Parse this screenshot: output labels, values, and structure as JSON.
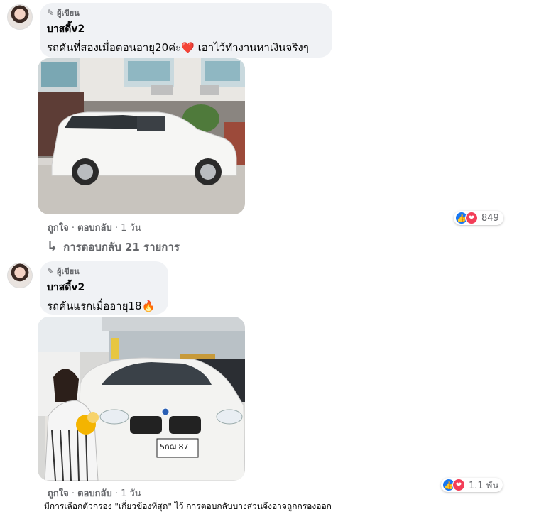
{
  "comments": [
    {
      "author_badge": "ผู้เขียน",
      "name": "บาสดี้v2",
      "text": "รถคันที่สองเมื่อตอนอายุ20ค่ะ❤️ เอาไว้ทำงานหาเงินจริงๆ",
      "like_label": "ถูกใจ",
      "reply_label": "ตอบกลับ",
      "time": "1 วัน",
      "reaction_count": "849"
    },
    {
      "author_badge": "ผู้เขียน",
      "name": "บาสดี้v2",
      "text": "รถคันแรกเมื่ออายุ18🔥",
      "like_label": "ถูกใจ",
      "reply_label": "ตอบกลับ",
      "time": "1 วัน",
      "reaction_count": "1.1 พัน"
    }
  ],
  "replies_link": "การตอบกลับ 21 รายการ",
  "photo2_plate": "5กฌ 87",
  "filter_notice": "มีการเลือกตัวกรอง \"เกี่ยวข้องที่สุด\" ไว้ การตอบกลับบางส่วนจึงอาจถูกกรองออก",
  "icons": [
    "pencil-icon",
    "reply-arrow-icon",
    "like-reaction-icon",
    "love-reaction-icon"
  ],
  "colors": {
    "bubble": "#f0f2f5",
    "like": "#1877f2",
    "love": "#f33e58",
    "secondary_text": "#65676b"
  }
}
